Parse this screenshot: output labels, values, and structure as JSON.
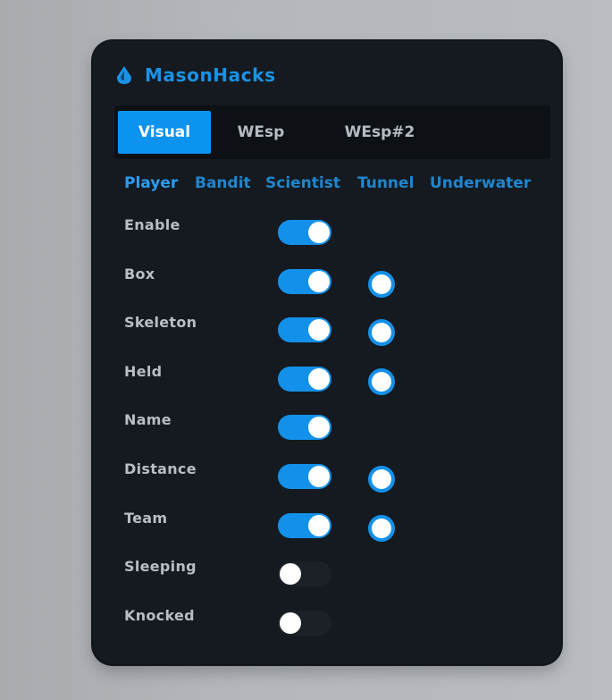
{
  "app": {
    "title": "MasonHacks",
    "logo_icon": "water-drop-icon"
  },
  "tabs": [
    {
      "label": "Visual",
      "active": true
    },
    {
      "label": "WEsp",
      "active": false
    },
    {
      "label": "WEsp#2",
      "active": false
    }
  ],
  "subtabs": [
    {
      "label": "Player",
      "active": true
    },
    {
      "label": "Bandit",
      "active": false
    },
    {
      "label": "Scientist",
      "active": false
    },
    {
      "label": "Tunnel",
      "active": false
    },
    {
      "label": "Underwater",
      "active": false
    }
  ],
  "options": [
    {
      "label": "Enable",
      "enabled": true,
      "has_color": false
    },
    {
      "label": "Box",
      "enabled": true,
      "has_color": true
    },
    {
      "label": "Skeleton",
      "enabled": true,
      "has_color": true
    },
    {
      "label": "Held",
      "enabled": true,
      "has_color": true
    },
    {
      "label": "Name",
      "enabled": true,
      "has_color": false
    },
    {
      "label": "Distance",
      "enabled": true,
      "has_color": true
    },
    {
      "label": "Team",
      "enabled": true,
      "has_color": true
    },
    {
      "label": "Sleeping",
      "enabled": false,
      "has_color": false
    },
    {
      "label": "Knocked",
      "enabled": false,
      "has_color": false
    }
  ],
  "colors": {
    "accent": "#1391ea",
    "panel_bg": "#151a20",
    "color_picker_value": "#ffffff"
  }
}
